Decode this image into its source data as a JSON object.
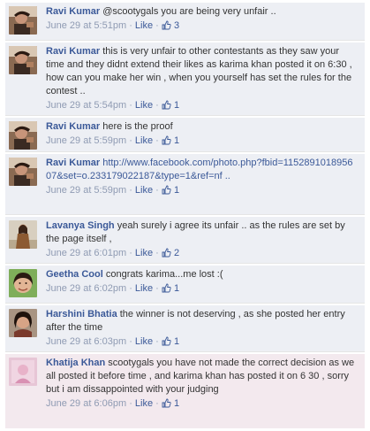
{
  "comments": [
    {
      "author": "Ravi Kumar",
      "text": "@scootygals you are being very unfair ..",
      "time": "June 29 at 5:51pm",
      "like_label": "Like",
      "likes": "3",
      "avatar_icon": "profile-photo-ravi"
    },
    {
      "author": "Ravi Kumar",
      "text": "this is very unfair to other contestants as they saw your time and they didnt extend their likes as karima khan posted it on 6:30 , how can you make her win , when you yourself has set the rules for the contest ..",
      "time": "June 29 at 5:54pm",
      "like_label": "Like",
      "likes": "1",
      "avatar_icon": "profile-photo-ravi"
    },
    {
      "author": "Ravi Kumar",
      "text": "here is the proof",
      "time": "June 29 at 5:59pm",
      "like_label": "Like",
      "likes": "1",
      "avatar_icon": "profile-photo-ravi"
    },
    {
      "author": "Ravi Kumar",
      "text": "http://www.facebook.com/photo.php?fbid=115289101895607&set=o.233179022187&type=1&ref=nf ..",
      "time": "June 29 at 5:59pm",
      "like_label": "Like",
      "likes": "1",
      "avatar_icon": "profile-photo-ravi"
    },
    {
      "author": "Lavanya Singh",
      "text": "yeah surely i agree its unfair .. as the rules are set by the page itself ,",
      "time": "June 29 at 6:01pm",
      "like_label": "Like",
      "likes": "2",
      "avatar_icon": "profile-photo-lavanya"
    },
    {
      "author": "Geetha Cool",
      "text": "congrats karima...me lost :(",
      "time": "June 29 at 6:02pm",
      "like_label": "Like",
      "likes": "1",
      "avatar_icon": "profile-photo-geetha"
    },
    {
      "author": "Harshini Bhatia",
      "text": "the winner is not deserving , as she posted her entry after the time",
      "time": "June 29 at 6:03pm",
      "like_label": "Like",
      "likes": "1",
      "avatar_icon": "profile-photo-harshini"
    },
    {
      "author": "Khatija Khan",
      "text": "scootygals you have not made the correct decision as we all posted it before time , and karima khan has posted it on 6 30 , sorry but i am dissappointed with your judging",
      "time": "June 29 at 6:06pm",
      "like_label": "Like",
      "likes": "1",
      "avatar_icon": "profile-photo-khatija"
    }
  ],
  "colors": {
    "author": "#3b5998",
    "comment_bg": "#edeff4",
    "highlight_bg": "#f3e9ee",
    "meta": "#8f9bb3"
  }
}
